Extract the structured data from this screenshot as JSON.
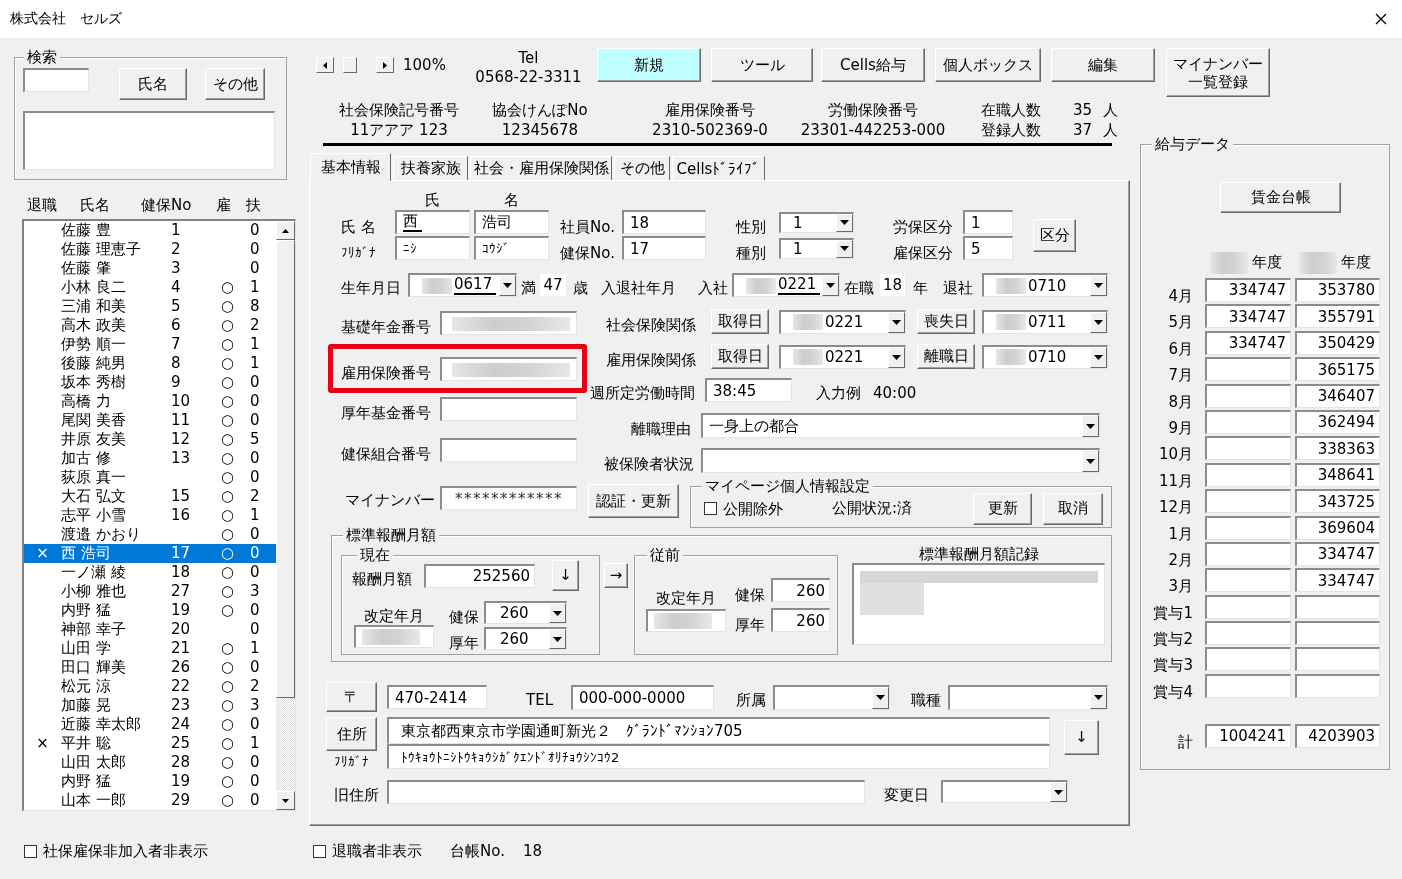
{
  "window": {
    "title": "株式会社　セルズ"
  },
  "search": {
    "legend": "検索",
    "buttons": [
      "氏名",
      "その他"
    ]
  },
  "employee_list": {
    "columns": [
      "退職",
      "氏名",
      "健保No",
      "雇",
      "扶"
    ],
    "rows": [
      {
        "name": "佐藤 豊",
        "health_no": "1",
        "dependents": "0",
        "selected": false
      },
      {
        "name": "佐藤 理恵子",
        "health_no": "2",
        "dependents": "0",
        "selected": false
      },
      {
        "name": "佐藤 肇",
        "health_no": "3",
        "dependents": "0",
        "selected": false
      },
      {
        "name": "小林 良二",
        "health_no": "4",
        "employment": "○",
        "dependents": "1",
        "selected": false
      },
      {
        "name": "三浦 和美",
        "health_no": "5",
        "employment": "○",
        "dependents": "8",
        "selected": false
      },
      {
        "name": "高木 政美",
        "health_no": "6",
        "employment": "○",
        "dependents": "2",
        "selected": false
      },
      {
        "name": "伊勢 順一",
        "health_no": "7",
        "employment": "○",
        "dependents": "1",
        "selected": false
      },
      {
        "name": "後藤 純男",
        "health_no": "8",
        "employment": "○",
        "dependents": "1",
        "selected": false
      },
      {
        "name": "坂本 秀樹",
        "health_no": "9",
        "employment": "○",
        "dependents": "0",
        "selected": false
      },
      {
        "name": "高橋 力",
        "health_no": "10",
        "employment": "○",
        "dependents": "0",
        "selected": false
      },
      {
        "name": "尾関 美香",
        "health_no": "11",
        "employment": "○",
        "dependents": "0",
        "selected": false
      },
      {
        "name": "井原 友美",
        "health_no": "12",
        "employment": "○",
        "dependents": "5",
        "selected": false
      },
      {
        "name": "加古 修",
        "health_no": "13",
        "employment": "○",
        "dependents": "0",
        "selected": false
      },
      {
        "name": "荻原 真一",
        "employment": "○",
        "dependents": "0",
        "selected": false
      },
      {
        "name": "大石 弘文",
        "health_no": "15",
        "employment": "○",
        "dependents": "2",
        "selected": false
      },
      {
        "name": "志平 小雪",
        "health_no": "16",
        "employment": "○",
        "dependents": "1",
        "selected": false
      },
      {
        "name": "渡邉 かおり",
        "employment": "○",
        "dependents": "0",
        "selected": false
      },
      {
        "mark": "×",
        "name": "西 浩司",
        "health_no": "17",
        "employment": "○",
        "dependents": "0",
        "selected": true
      },
      {
        "name": "一ノ瀬 綾",
        "health_no": "18",
        "employment": "○",
        "dependents": "0",
        "selected": false
      },
      {
        "name": "小柳 雅也",
        "health_no": "27",
        "employment": "○",
        "dependents": "3",
        "selected": false
      },
      {
        "name": "内野 猛",
        "health_no": "19",
        "employment": "○",
        "dependents": "0",
        "selected": false
      },
      {
        "name": "神部 幸子",
        "health_no": "20",
        "dependents": "0",
        "selected": false
      },
      {
        "name": "山田 学",
        "health_no": "21",
        "employment": "○",
        "dependents": "1",
        "selected": false
      },
      {
        "name": "田口 輝美",
        "health_no": "26",
        "employment": "○",
        "dependents": "0",
        "selected": false
      },
      {
        "name": "松元 涼",
        "health_no": "22",
        "employment": "○",
        "dependents": "2",
        "selected": false
      },
      {
        "name": "加藤 晃",
        "health_no": "23",
        "employment": "○",
        "dependents": "3",
        "selected": false
      },
      {
        "name": "近藤 幸太郎",
        "health_no": "24",
        "employment": "○",
        "dependents": "0",
        "selected": false
      },
      {
        "mark": "×",
        "name": "平井 聡",
        "health_no": "25",
        "employment": "○",
        "dependents": "1",
        "selected": false
      },
      {
        "name": "山田 太郎",
        "health_no": "28",
        "employment": "○",
        "dependents": "0",
        "selected": false
      },
      {
        "name": "内野 猛",
        "health_no": "19",
        "employment": "○",
        "dependents": "0",
        "selected": false
      },
      {
        "name": "山本 一郎",
        "health_no": "29",
        "employment": "○",
        "dependents": "0",
        "selected": false
      }
    ]
  },
  "hide_uninsured": {
    "label": "社保雇保非加入者非表示",
    "checked": false
  },
  "toolbar": {
    "zoom": "100%",
    "tel_label": "Tel",
    "tel": "0568-22-3311",
    "buttons": [
      {
        "label": "新規",
        "highlighted": true
      },
      {
        "label": "ツール",
        "highlighted": false
      },
      {
        "label": "Cells給与",
        "highlighted": false
      },
      {
        "label": "個人ボックス",
        "highlighted": false
      },
      {
        "label": "編集",
        "highlighted": false
      },
      {
        "label": "マイナンバー一覧登録",
        "highlighted": false
      }
    ]
  },
  "company_info": {
    "items": [
      {
        "label": "社会保険記号番号",
        "value": "11アアア 123"
      },
      {
        "label": "協会けんぽNo",
        "value": "12345678"
      },
      {
        "label": "雇用保険番号",
        "value": "2310-502369-0"
      },
      {
        "label": "労働保険番号",
        "value": "23301-442253-000"
      }
    ],
    "headcounts": [
      {
        "label": "在職人数",
        "value": "35",
        "unit": "人"
      },
      {
        "label": "登録人数",
        "value": "37",
        "unit": "人"
      }
    ]
  },
  "tabs": [
    {
      "label": "基本情報",
      "selected": true
    },
    {
      "label": "扶養家族",
      "selected": false
    },
    {
      "label": "社会・雇用保険関係",
      "selected": false
    },
    {
      "label": "その他",
      "selected": false
    },
    {
      "label": "Cellsﾄﾞﾗｲﾌﾞ",
      "selected": false
    }
  ],
  "basic_info": {
    "name": {
      "label": "氏 名",
      "headers": [
        "氏",
        "名"
      ],
      "family": {
        "value": "西",
        "underlined": true
      },
      "given": "浩司"
    },
    "furigana": {
      "label": "ﾌﾘｶﾞﾅ",
      "family": "ﾆｼ",
      "given": "ｺｳｼﾞ"
    },
    "employee_no": {
      "label": "社員No.",
      "value": "18"
    },
    "health_no": {
      "label": "健保No.",
      "value": "17"
    },
    "gender": {
      "label": "性別",
      "value": "1"
    },
    "category": {
      "label": "種別",
      "value": "1"
    },
    "labor_class": {
      "label": "労保区分",
      "value": "1"
    },
    "employment_class": {
      "label": "雇保区分",
      "value": "5"
    },
    "class_button": "区分",
    "birth": {
      "label": "生年月日",
      "date": {
        "value": "0617",
        "redacted": true,
        "underlined": true
      }
    },
    "age": {
      "prefix": "満",
      "value": "47",
      "suffix": "歳"
    },
    "join_leave_label": "入退社年月",
    "joined": {
      "label": "入社",
      "date": {
        "value": "0221",
        "redacted": true,
        "underlined": true
      }
    },
    "tenure": {
      "prefix": "在職",
      "value": "18",
      "suffix": "年"
    },
    "left": {
      "label": "退社",
      "date": {
        "value": "0710",
        "redacted": true
      }
    },
    "id_numbers": [
      {
        "label": "基礎年金番号",
        "redacted": true,
        "highlighted": false
      },
      {
        "label": "雇用保険番号",
        "redacted": true,
        "highlighted": true
      },
      {
        "label": "厚年基金番号",
        "redacted": false,
        "highlighted": false
      },
      {
        "label": "健保組合番号",
        "redacted": false,
        "highlighted": false
      }
    ],
    "insurance": [
      {
        "label": "社会保険関係",
        "acquired_button": "取得日",
        "acquired": {
          "value": "0221",
          "redacted": true
        },
        "lost_button": "喪失日",
        "lost": {
          "value": "0711",
          "redacted": true
        }
      },
      {
        "label": "雇用保険関係",
        "acquired_button": "取得日",
        "acquired": {
          "value": "0221",
          "redacted": true
        },
        "lost_button": "離職日",
        "lost": {
          "value": "0710",
          "redacted": true
        }
      }
    ],
    "weekly_hours": {
      "label": "週所定労働時間",
      "value": "38:45",
      "example_label": "入力例",
      "example": "40:00"
    },
    "separation_reason": {
      "label": "離職理由",
      "value": "一身上の都合"
    },
    "insured_status": {
      "label": "被保険者状況"
    },
    "my_number": {
      "label": "マイナンバー",
      "value": "************",
      "button": "認証・更新"
    },
    "mypage": {
      "legend": "マイページ個人情報設定",
      "exclude": {
        "label": "公開除外",
        "checked": false
      },
      "status": "公開状況:済",
      "buttons": [
        "更新",
        "取消"
      ]
    },
    "standard_pay": {
      "legend": "標準報酬月額",
      "current": {
        "legend": "現在",
        "monthly_label": "報酬月額",
        "monthly": "252560",
        "down_button": "↓",
        "revision_label": "改定年月",
        "revision": {
          "redacted": true
        },
        "health_label": "健保",
        "health": "260",
        "pension_label": "厚年",
        "pension": "260"
      },
      "copy_button": "→",
      "previous": {
        "legend": "従前",
        "revision_label": "改定年月",
        "revision": {
          "redacted": true
        },
        "health_label": "健保",
        "health": "260",
        "pension_label": "厚年",
        "pension": "260"
      },
      "record_label": "標準報酬月額記録",
      "record": {
        "redacted": true
      }
    },
    "contact": {
      "postal_button": "〒",
      "postal": "470-2414",
      "tel_label": "TEL",
      "tel": "000-000-0000",
      "department_label": "所属",
      "job_label": "職種",
      "address_button": "住所",
      "address": "東京都西東京市学園通町新光２　ｸﾞﾗﾝﾄﾞﾏﾝｼｮﾝ705",
      "furigana_label": "ﾌﾘｶﾞﾅ",
      "address_furigana": "ﾄｳｷｮｳﾄﾆｼﾄｳｷｮｳｼｶﾞｸｴﾝﾄﾞｵﾘﾁｮｳｼﾝｺｳ2",
      "copy_button": "↓",
      "old_address_label": "旧住所",
      "changed_label": "変更日"
    }
  },
  "footer": {
    "hide_retired": {
      "label": "退職者非表示",
      "checked": false
    },
    "ledger_label": "台帳No.",
    "ledger_no": "18"
  },
  "salary_data": {
    "legend": "給与データ",
    "ledger_button": "賃金台帳",
    "years": [
      {
        "label": "年度",
        "redacted": true
      },
      {
        "label": "年度",
        "redacted": true
      }
    ],
    "rows": [
      {
        "label": "4月",
        "year_1": "334747",
        "year_2": "353780"
      },
      {
        "label": "5月",
        "year_1": "334747",
        "year_2": "355791"
      },
      {
        "label": "6月",
        "year_1": "334747",
        "year_2": "350429"
      },
      {
        "label": "7月",
        "year_2": "365175"
      },
      {
        "label": "8月",
        "year_2": "346407"
      },
      {
        "label": "9月",
        "year_2": "362494"
      },
      {
        "label": "10月",
        "year_2": "338363"
      },
      {
        "label": "11月",
        "year_2": "348641"
      },
      {
        "label": "12月",
        "year_2": "343725"
      },
      {
        "label": "1月",
        "year_2": "369604"
      },
      {
        "label": "2月",
        "year_2": "334747"
      },
      {
        "label": "3月",
        "year_2": "334747"
      },
      {
        "label": "賞与1"
      },
      {
        "label": "賞与2"
      },
      {
        "label": "賞与3"
      },
      {
        "label": "賞与4"
      }
    ],
    "total": {
      "label": "計",
      "year_1": "1004241",
      "year_2": "4203903"
    }
  }
}
